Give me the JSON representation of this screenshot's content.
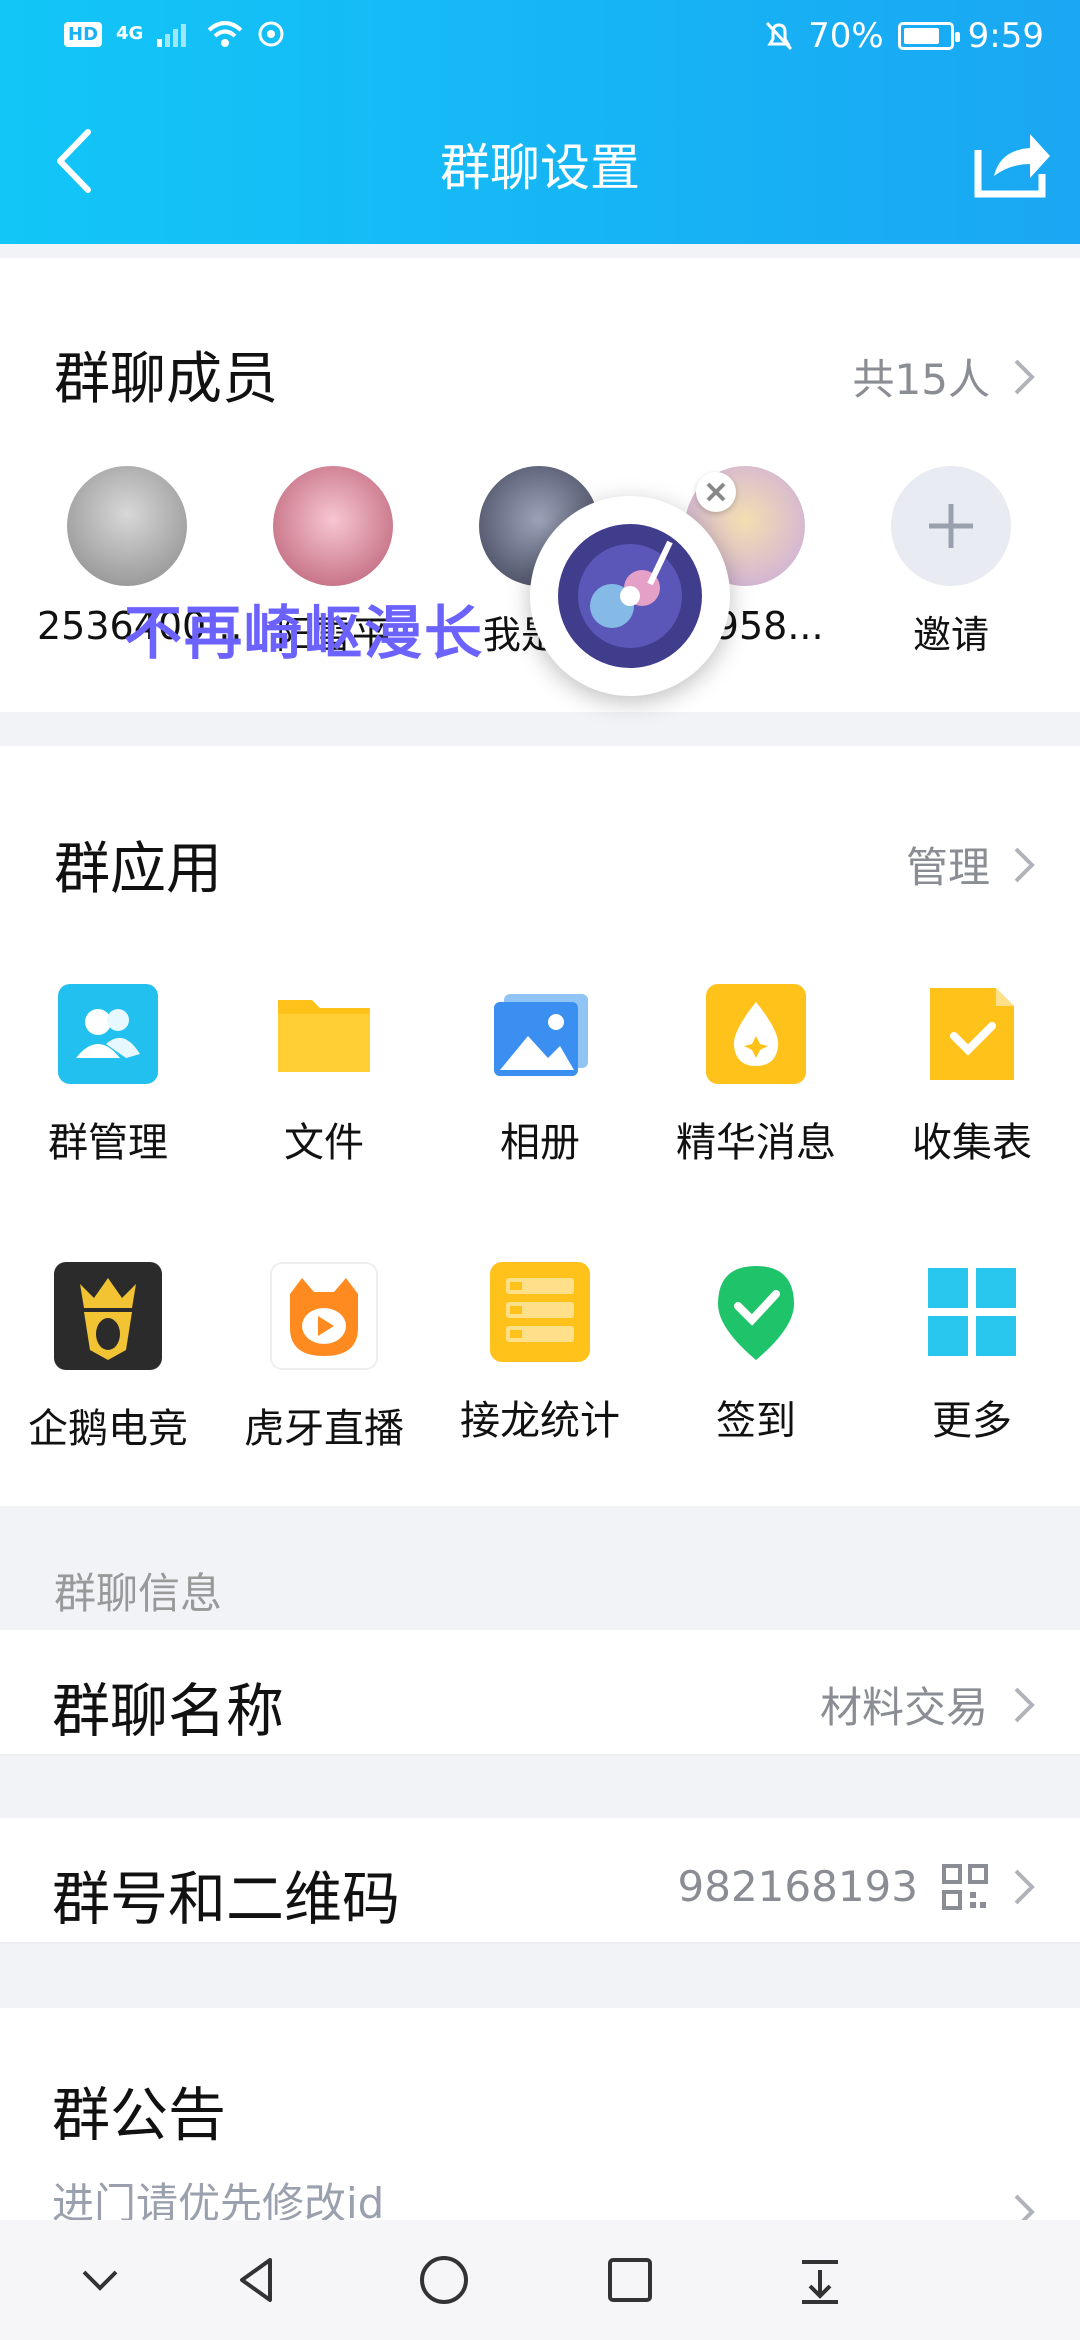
{
  "status_bar": {
    "network": "4G",
    "hd": "HD",
    "battery_text": "70%",
    "time": "9:59"
  },
  "header": {
    "title": "群聊设置"
  },
  "members_section": {
    "title": "群聊成员",
    "count": "共15人",
    "members": [
      {
        "name": "2536400..."
      },
      {
        "name": "阳雪平"
      },
      {
        "name": "我是..."
      },
      {
        "name": "15958..."
      },
      {
        "name": "邀请"
      }
    ],
    "overlay_text": "不再崎岖漫长"
  },
  "apps_section": {
    "title": "群应用",
    "manage": "管理",
    "apps": [
      {
        "label": "群管理",
        "icon": "group-manage-icon"
      },
      {
        "label": "文件",
        "icon": "folder-icon"
      },
      {
        "label": "相册",
        "icon": "album-icon"
      },
      {
        "label": "精华消息",
        "icon": "essence-icon"
      },
      {
        "label": "收集表",
        "icon": "form-icon"
      },
      {
        "label": "企鹅电竞",
        "icon": "penguin-esports-icon"
      },
      {
        "label": "虎牙直播",
        "icon": "huya-icon"
      },
      {
        "label": "接龙统计",
        "icon": "relay-stats-icon"
      },
      {
        "label": "签到",
        "icon": "checkin-icon"
      },
      {
        "label": "更多",
        "icon": "more-grid-icon"
      }
    ]
  },
  "group_info": {
    "label": "群聊信息",
    "name_title": "群聊名称",
    "name_value": "材料交易",
    "number_title": "群号和二维码",
    "number_value": "982168193",
    "notice_title": "群公告",
    "notice_value": "进门请优先修改id"
  },
  "colors": {
    "header_start": "#12c6f7",
    "header_end": "#1aa7f3",
    "accent": "#1aa7f3"
  }
}
